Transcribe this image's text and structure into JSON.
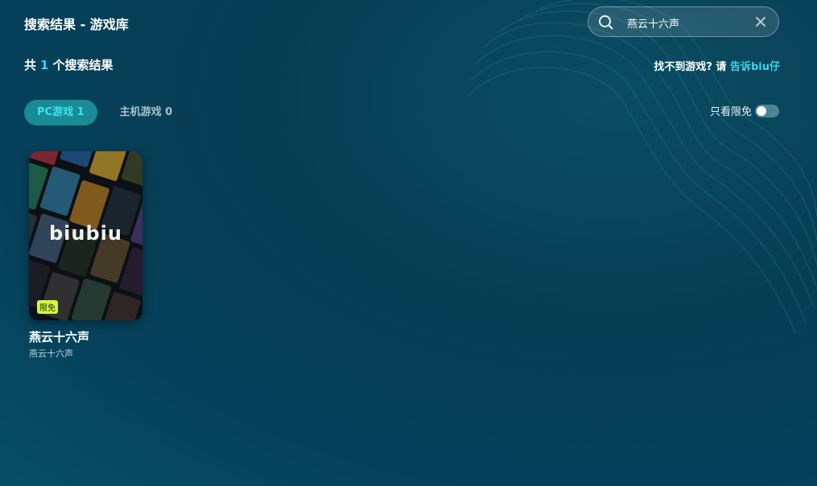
{
  "header": {
    "title": "搜索结果 - 游戏库"
  },
  "results": {
    "prefix": "共",
    "count": "1",
    "suffix": "个搜索结果"
  },
  "search": {
    "value": "燕云十六声",
    "icon": "search-icon",
    "clear_icon": "close-icon"
  },
  "feedback": {
    "question": "找不到游戏? 请",
    "link": "告诉biu仔"
  },
  "tabs": [
    {
      "label": "PC游戏 1",
      "active": true
    },
    {
      "label": "主机游戏 0",
      "active": false
    }
  ],
  "filter": {
    "label": "只看限免",
    "enabled": false
  },
  "games": [
    {
      "logo": "biubiu",
      "badge": "限免",
      "title": "燕云十六声",
      "subtitle": "燕云十六声"
    }
  ],
  "colors": {
    "accent": "#38d6ea",
    "badge": "#d4f542",
    "tab_active_bg": "#1a8a94"
  }
}
